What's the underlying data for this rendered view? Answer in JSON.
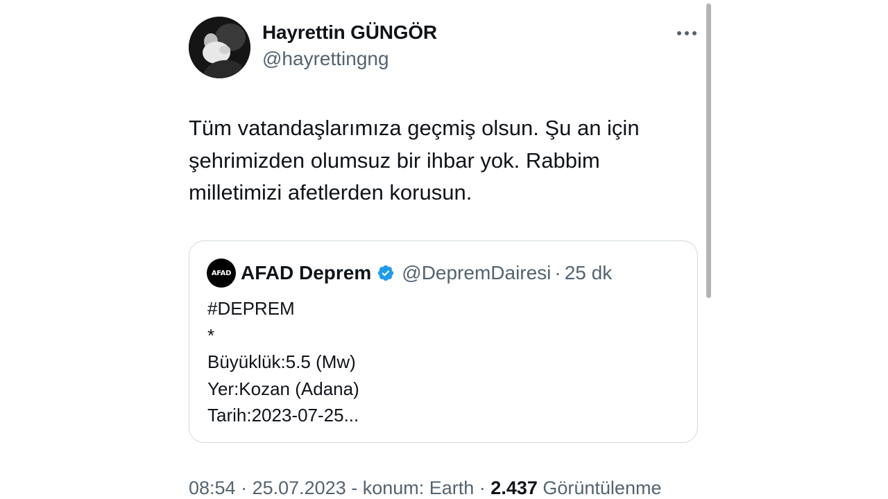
{
  "author": {
    "name": "Hayrettin GÜNGÖR",
    "handle": "@hayrettingng",
    "avatar_icon": "profile-photo"
  },
  "more_icon": "more-options-icon",
  "tweet_text": "Tüm vatandaşlarımıza geçmiş olsun. Şu an için\nşehrimizden olumsuz bir ihbar yok. Rabbim\nmilletimizi afetlerden korusun.",
  "quoted_tweet": {
    "avatar_text": "AFAD",
    "name": "AFAD Deprem",
    "verified_icon": "verified-badge-icon",
    "verified_color": "#1d9bf0",
    "handle": "@DepremDairesi",
    "separator": "·",
    "time": "25 dk",
    "lines": [
      "#DEPREM",
      "*",
      "Büyüklük:5.5 (Mw)",
      "Yer:Kozan (Adana)",
      "Tarih:2023-07-25..."
    ]
  },
  "meta": {
    "time": "08:54",
    "sep1": " · ",
    "date": "25.07.2023",
    "location_text": " - konum: Earth",
    "sep2": " · ",
    "views_count": "2.437",
    "views_label": " Görüntülenme"
  },
  "colors": {
    "text_primary": "#0f1419",
    "text_secondary": "#536471",
    "border": "#cfd9de",
    "accent": "#1d9bf0"
  }
}
